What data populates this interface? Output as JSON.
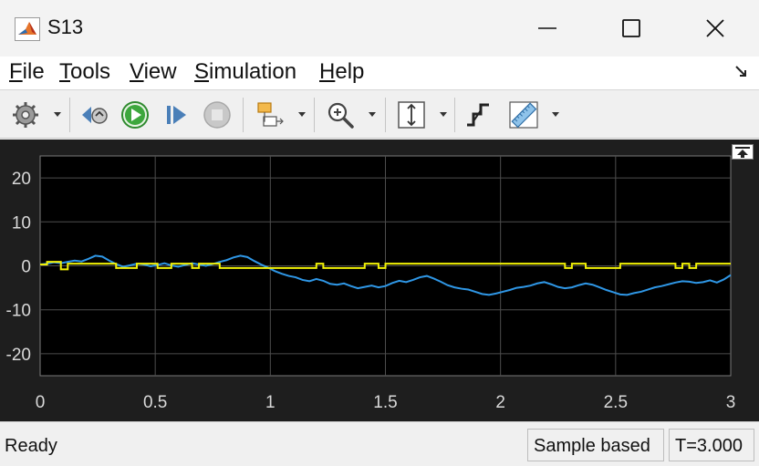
{
  "window": {
    "title": "S13",
    "minimize_label": "minimize",
    "maximize_label": "maximize",
    "close_label": "close"
  },
  "menu": {
    "items": [
      {
        "key": "F",
        "rest": "ile"
      },
      {
        "key": "T",
        "rest": "ools"
      },
      {
        "key": "V",
        "rest": "iew"
      },
      {
        "key": "S",
        "rest": "imulation"
      },
      {
        "key": "H",
        "rest": "elp"
      }
    ]
  },
  "toolbar": {
    "icons": [
      "settings-icon",
      "step-back-icon",
      "run-icon",
      "step-forward-icon",
      "stop-icon",
      "highlight-icon",
      "zoom-icon",
      "autoscale-icon",
      "triggers-icon",
      "measurements-icon"
    ]
  },
  "colors": {
    "plot_background": "#000000",
    "frame_background": "#1e1e1e",
    "grid": "#4d4d4d",
    "series_blue": "#2f97e6",
    "series_yellow": "#f2f207"
  },
  "chart_data": {
    "type": "line",
    "title": "",
    "xlabel": "",
    "ylabel": "",
    "xlim": [
      0,
      3
    ],
    "ylim": [
      -25,
      25
    ],
    "x_ticks": [
      "0",
      "0.5",
      "1",
      "1.5",
      "2",
      "2.5",
      "3"
    ],
    "y_ticks": [
      "20",
      "10",
      "0",
      "-10",
      "-20"
    ],
    "grid": true,
    "series": [
      {
        "color": "#2f97e6",
        "x": [
          0,
          0.03,
          0.06,
          0.09,
          0.12,
          0.15,
          0.18,
          0.21,
          0.24,
          0.27,
          0.3,
          0.33,
          0.36,
          0.39,
          0.42,
          0.45,
          0.48,
          0.51,
          0.54,
          0.57,
          0.6,
          0.63,
          0.66,
          0.69,
          0.72,
          0.75,
          0.78,
          0.81,
          0.84,
          0.87,
          0.9,
          0.93,
          0.96,
          0.99,
          1.02,
          1.05,
          1.08,
          1.11,
          1.14,
          1.17,
          1.2,
          1.23,
          1.26,
          1.29,
          1.32,
          1.35,
          1.38,
          1.41,
          1.44,
          1.47,
          1.5,
          1.53,
          1.56,
          1.59,
          1.62,
          1.65,
          1.68,
          1.71,
          1.74,
          1.77,
          1.8,
          1.83,
          1.86,
          1.89,
          1.92,
          1.95,
          1.98,
          2.01,
          2.04,
          2.07,
          2.1,
          2.13,
          2.16,
          2.19,
          2.22,
          2.25,
          2.28,
          2.31,
          2.34,
          2.37,
          2.4,
          2.43,
          2.46,
          2.49,
          2.52,
          2.55,
          2.58,
          2.61,
          2.64,
          2.67,
          2.7,
          2.73,
          2.76,
          2.79,
          2.82,
          2.85,
          2.88,
          2.91,
          2.94,
          2.97,
          3.0
        ],
        "y": [
          0.3,
          0.5,
          0.8,
          0.6,
          0.9,
          1.2,
          1.0,
          1.6,
          2.3,
          2.1,
          1.2,
          0.4,
          -0.2,
          0.1,
          0.5,
          0.3,
          -0.1,
          0.2,
          0.6,
          0.1,
          -0.2,
          0.2,
          0.6,
          0.3,
          0.0,
          0.4,
          0.9,
          1.3,
          1.9,
          2.3,
          2.0,
          1.1,
          0.3,
          -0.4,
          -1.2,
          -1.8,
          -2.3,
          -2.6,
          -3.2,
          -3.5,
          -3.0,
          -3.4,
          -4.1,
          -4.3,
          -4.0,
          -4.6,
          -5.1,
          -4.8,
          -4.5,
          -4.9,
          -4.6,
          -3.9,
          -3.4,
          -3.7,
          -3.2,
          -2.6,
          -2.3,
          -2.9,
          -3.6,
          -4.4,
          -4.9,
          -5.2,
          -5.4,
          -5.9,
          -6.4,
          -6.6,
          -6.3,
          -5.9,
          -5.5,
          -5.0,
          -4.8,
          -4.5,
          -4.0,
          -3.7,
          -4.2,
          -4.8,
          -5.1,
          -4.9,
          -4.4,
          -4.0,
          -4.3,
          -4.9,
          -5.5,
          -6.0,
          -6.5,
          -6.6,
          -6.2,
          -5.9,
          -5.4,
          -4.9,
          -4.6,
          -4.2,
          -3.8,
          -3.5,
          -3.6,
          -3.9,
          -3.7,
          -3.3,
          -3.8,
          -3.1,
          -2.1
        ]
      },
      {
        "color": "#f2f207",
        "x": [
          0,
          0.03,
          0.06,
          0.09,
          0.12,
          0.15,
          0.18,
          0.21,
          0.24,
          0.27,
          0.3,
          0.33,
          0.36,
          0.39,
          0.42,
          0.45,
          0.48,
          0.51,
          0.54,
          0.57,
          0.6,
          0.63,
          0.66,
          0.69,
          0.72,
          0.75,
          0.78,
          0.81,
          0.84,
          0.87,
          0.9,
          0.93,
          0.96,
          0.99,
          1.02,
          1.05,
          1.08,
          1.11,
          1.14,
          1.17,
          1.2,
          1.23,
          1.26,
          1.29,
          1.32,
          1.35,
          1.38,
          1.41,
          1.44,
          1.47,
          1.5,
          1.53,
          1.56,
          1.59,
          1.62,
          1.65,
          1.68,
          1.71,
          1.74,
          1.77,
          1.8,
          1.83,
          1.86,
          1.89,
          1.92,
          1.95,
          1.98,
          2.01,
          2.04,
          2.07,
          2.1,
          2.13,
          2.16,
          2.19,
          2.22,
          2.25,
          2.28,
          2.31,
          2.34,
          2.37,
          2.4,
          2.43,
          2.46,
          2.49,
          2.52,
          2.55,
          2.58,
          2.61,
          2.64,
          2.67,
          2.7,
          2.73,
          2.76,
          2.79,
          2.82,
          2.85,
          2.88,
          2.91,
          2.94,
          2.97,
          3.0
        ],
        "y": [
          0.3,
          0.9,
          0.9,
          -0.8,
          0.5,
          0.5,
          0.5,
          0.5,
          0.5,
          0.5,
          0.5,
          -0.5,
          -0.5,
          -0.5,
          0.5,
          0.5,
          0.5,
          -0.5,
          -0.5,
          0.5,
          0.5,
          0.5,
          -0.5,
          0.5,
          0.5,
          0.5,
          -0.5,
          -0.5,
          -0.5,
          -0.5,
          -0.5,
          -0.5,
          -0.5,
          -0.5,
          -0.5,
          -0.5,
          -0.5,
          -0.5,
          -0.5,
          -0.5,
          0.5,
          -0.5,
          -0.5,
          -0.5,
          -0.5,
          -0.5,
          -0.5,
          0.5,
          0.5,
          -0.5,
          0.5,
          0.5,
          0.5,
          0.5,
          0.5,
          0.5,
          0.5,
          0.5,
          0.5,
          0.5,
          0.5,
          0.5,
          0.5,
          0.5,
          0.5,
          0.5,
          0.5,
          0.5,
          0.5,
          0.5,
          0.5,
          0.5,
          0.5,
          0.5,
          0.5,
          0.5,
          -0.5,
          0.5,
          0.5,
          -0.5,
          -0.5,
          -0.5,
          -0.5,
          -0.5,
          0.5,
          0.5,
          0.5,
          0.5,
          0.5,
          0.5,
          0.5,
          0.5,
          -0.5,
          0.5,
          -0.5,
          0.5,
          0.5,
          0.5,
          0.5,
          0.5,
          0.5
        ]
      }
    ]
  },
  "status": {
    "state": "Ready",
    "mode": "Sample based",
    "time": "T=3.000"
  }
}
